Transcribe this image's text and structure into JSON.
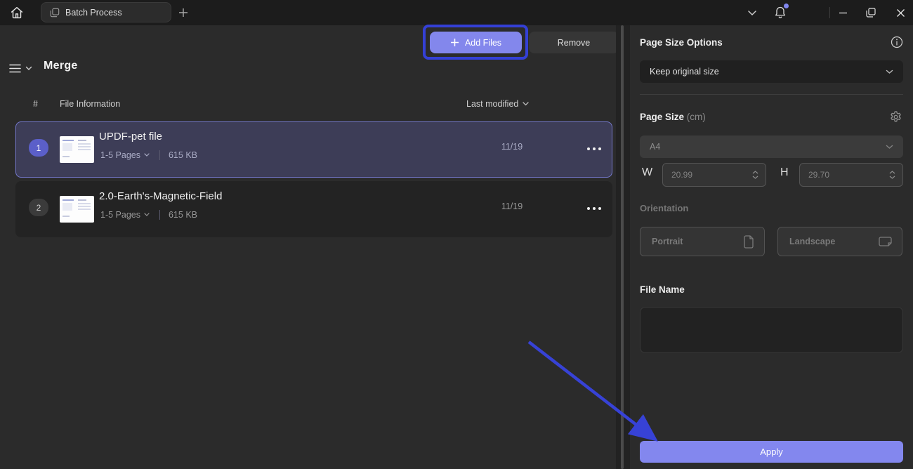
{
  "titlebar": {
    "tab_label": "Batch Process"
  },
  "toolbar": {
    "title": "Merge",
    "add_files_label": "Add Files",
    "remove_label": "Remove"
  },
  "table": {
    "headers": {
      "index": "#",
      "file_info": "File Information",
      "last_modified": "Last modified"
    },
    "rows": [
      {
        "index": "1",
        "name": "UPDF-pet file",
        "pages": "1-5 Pages",
        "size": "615 KB",
        "modified": "11/19",
        "selected": true
      },
      {
        "index": "2",
        "name": "2.0-Earth's-Magnetic-Field",
        "pages": "1-5 Pages",
        "size": "615 KB",
        "modified": "11/19",
        "selected": false
      }
    ]
  },
  "sidebar": {
    "page_size_options": {
      "label": "Page Size Options",
      "selected_value": "Keep original size"
    },
    "page_size": {
      "label": "Page Size",
      "unit": "(cm)",
      "preset_value": "A4",
      "width_label": "W",
      "width_value": "20.99",
      "height_label": "H",
      "height_value": "29.70"
    },
    "orientation": {
      "label": "Orientation",
      "portrait_label": "Portrait",
      "landscape_label": "Landscape"
    },
    "file_name": {
      "label": "File Name",
      "value": ""
    },
    "apply_label": "Apply"
  },
  "colors": {
    "accent_purple": "#8387ec",
    "annotation_blue": "#3440d6",
    "selected_row_bg": "#3d3d57",
    "selected_row_border": "#7478cb",
    "notification_dot": "#8187f0",
    "panel_bg": "#2b2b2b",
    "titlebar_bg": "#1c1c1c"
  }
}
